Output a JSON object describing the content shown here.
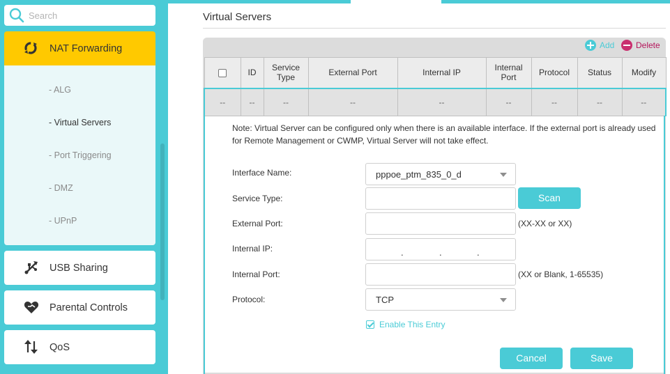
{
  "sidebar": {
    "search_placeholder": "Search",
    "active_section": {
      "label": "NAT Forwarding",
      "icon": "nat-forwarding-icon"
    },
    "sub_items": [
      {
        "label": "- ALG",
        "active": false
      },
      {
        "label": "- Virtual Servers",
        "active": true
      },
      {
        "label": "- Port Triggering",
        "active": false
      },
      {
        "label": "- DMZ",
        "active": false
      },
      {
        "label": "- UPnP",
        "active": false
      }
    ],
    "menu": [
      {
        "label": "USB Sharing",
        "icon": "usb-icon"
      },
      {
        "label": "Parental Controls",
        "icon": "heart-icon"
      },
      {
        "label": "QoS",
        "icon": "qos-arrows-icon"
      }
    ]
  },
  "main": {
    "title": "Virtual Servers",
    "toolbar": {
      "add_label": "Add",
      "delete_label": "Delete"
    },
    "table": {
      "columns": [
        "",
        "ID",
        "Service Type",
        "External Port",
        "Internal IP",
        "Internal Port",
        "Protocol",
        "Status",
        "Modify"
      ],
      "rows": [
        [
          "--",
          "--",
          "--",
          "--",
          "--",
          "--",
          "--",
          "--",
          "--"
        ]
      ]
    },
    "note": "Note: Virtual Server can be configured only when there is an available interface. If the external port is already used for Remote Management or CWMP, Virtual Server will not take effect.",
    "form": {
      "interface_name": {
        "label": "Interface Name:",
        "value": "pppoe_ptm_835_0_d"
      },
      "service_type": {
        "label": "Service Type:",
        "value": "",
        "scan_label": "Scan"
      },
      "external_port": {
        "label": "External Port:",
        "value": "",
        "hint": "(XX-XX or XX)"
      },
      "internal_ip": {
        "label": "Internal IP:",
        "dots": [
          ".",
          ".",
          "."
        ]
      },
      "internal_port": {
        "label": "Internal Port:",
        "value": "",
        "hint": "(XX or Blank, 1-65535)"
      },
      "protocol": {
        "label": "Protocol:",
        "value": "TCP"
      },
      "enable_entry": {
        "label": "Enable This Entry",
        "checked": true
      }
    },
    "buttons": {
      "cancel": "Cancel",
      "save": "Save"
    }
  },
  "colors": {
    "accent": "#4acbd6",
    "active_section": "#ffc900",
    "delete": "#c9306f"
  }
}
